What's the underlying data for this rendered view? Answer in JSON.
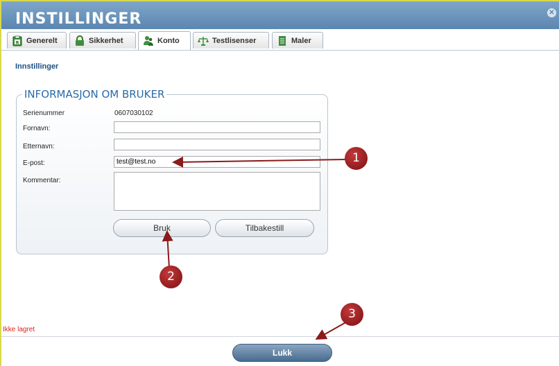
{
  "window": {
    "title": "INSTILLINGER",
    "close_icon": "close-icon"
  },
  "tabs": [
    {
      "label": "Generelt",
      "icon": "clipboard-icon"
    },
    {
      "label": "Sikkerhet",
      "icon": "lock-icon"
    },
    {
      "label": "Konto",
      "icon": "users-icon",
      "active": true
    },
    {
      "label": "Testlisenser",
      "icon": "scale-icon"
    },
    {
      "label": "Maler",
      "icon": "document-icon"
    }
  ],
  "page": {
    "heading": "Innstillinger"
  },
  "user_info": {
    "legend": "INFORMASJON OM BRUKER",
    "serial_label": "Serienummer",
    "serial_value": "0607030102",
    "firstname_label": "Fornavn:",
    "firstname_value": "",
    "lastname_label": "Etternavn:",
    "lastname_value": "",
    "email_label": "E-post:",
    "email_value": "test@test.no",
    "comment_label": "Kommentar:",
    "comment_value": "",
    "apply_label": "Bruk",
    "reset_label": "Tilbakestill"
  },
  "status": {
    "text": "Ikke lagret",
    "color": "#e0201c"
  },
  "footer": {
    "close_label": "Lukk"
  },
  "annotations": [
    "1",
    "2",
    "3"
  ],
  "colors": {
    "title_bar": "#6f98bf",
    "accent": "#2a6aa8",
    "marker": "#9b1c1f"
  }
}
